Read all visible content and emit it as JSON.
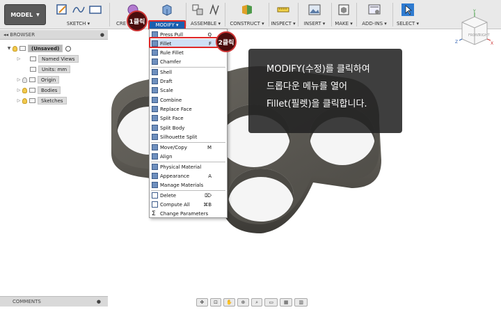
{
  "toolbar": {
    "workspace_label": "MODEL",
    "groups": [
      "SKETCH",
      "CREATE",
      "MODIFY",
      "ASSEMBLE",
      "CONSTRUCT",
      "INSPECT",
      "INSERT",
      "MAKE",
      "ADD-INS",
      "SELECT"
    ],
    "create_partial": "CRE",
    "modify_label": "MODIFY ▾"
  },
  "badges": {
    "first": "1클릭",
    "second": "2클릭"
  },
  "browser": {
    "title": "BROWSER",
    "root": "(Unsaved)",
    "items": [
      "Named Views",
      "Units: mm",
      "Origin",
      "Bodies",
      "Sketches"
    ]
  },
  "menu": {
    "items": [
      {
        "label": "Press Pull",
        "key": "Q"
      },
      {
        "label": "Fillet",
        "key": "F"
      },
      {
        "label": "Rule Fillet",
        "key": ""
      },
      {
        "label": "Chamfer",
        "key": ""
      },
      {
        "label": "Shell",
        "key": ""
      },
      {
        "label": "Draft",
        "key": ""
      },
      {
        "label": "Scale",
        "key": ""
      },
      {
        "label": "Combine",
        "key": ""
      },
      {
        "label": "Replace Face",
        "key": ""
      },
      {
        "label": "Split Face",
        "key": ""
      },
      {
        "label": "Split Body",
        "key": ""
      },
      {
        "label": "Silhouette Split",
        "key": ""
      },
      {
        "label": "Move/Copy",
        "key": "M"
      },
      {
        "label": "Align",
        "key": ""
      },
      {
        "label": "Physical Material",
        "key": ""
      },
      {
        "label": "Appearance",
        "key": "A"
      },
      {
        "label": "Manage Materials",
        "key": ""
      },
      {
        "label": "Delete",
        "key": "⌦"
      },
      {
        "label": "Compute All",
        "key": "⌘B"
      },
      {
        "label": "Change Parameters",
        "key": ""
      }
    ]
  },
  "callout": {
    "line1": "MODIFY(수정)를 클릭하여",
    "line2": "드롭다운 메뉴를 열어",
    "line3": "Fillet(필렛)을 클릭합니다."
  },
  "comments": {
    "title": "COMMENTS"
  },
  "viewcube": {
    "front": "FRONT",
    "right": "RIGHT",
    "axis_x": "X",
    "axis_y": "Y",
    "axis_z": "Z"
  },
  "colors": {
    "accent": "#1a5fb0",
    "highlight": "#e02828",
    "model": "#5e5b55"
  }
}
